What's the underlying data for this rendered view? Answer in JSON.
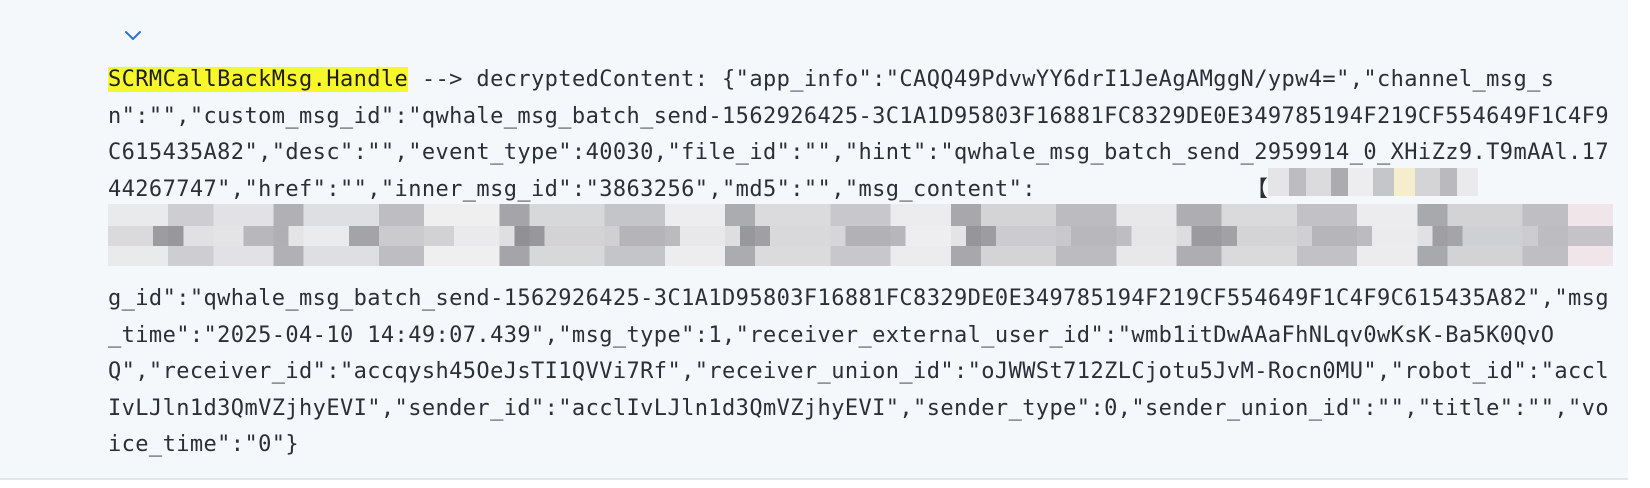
{
  "log_entry": {
    "tag": "SCRMCallBackMsg.Handle",
    "text_before_redaction": " --> decryptedContent: {\"app_info\":\"CAQQ49PdvwYY6drI1JeAgAMggN/ypw4=\",\"channel_msg_sn\":\"\",\"custom_msg_id\":\"qwhale_msg_batch_send-1562926425-3C1A1D95803F16881FC8329DE0E349785194F219CF554649F1C4F9C615435A82\",\"desc\":\"\",\"event_type\":40030,\"file_id\":\"\",\"hint\":\"qwhale_msg_batch_send_2959914_0_XHiZz9.T9mAAl.1744267747\",\"href\":\"\",\"inner_msg_id\":\"3863256\",\"md5\":\"\",\"msg_content\":",
    "redacted_tail_char": "【",
    "text_after_redaction": "g_id\":\"qwhale_msg_batch_send-1562926425-3C1A1D95803F16881FC8329DE0E349785194F219CF554649F1C4F9C615435A82\",\"msg_time\":\"2025-04-10 14:49:07.439\",\"msg_type\":1,\"receiver_external_user_id\":\"wmb1itDwAAaFhNLqv0wKsK-Ba5K0QvOQ\",\"receiver_id\":\"accqysh45OeJsTI1QVVi7Rf\",\"receiver_union_id\":\"oJWWSt712ZLCjotu5JvM-Rocn0MU\",\"robot_id\":\"acclIvLJln1d3QmVZjhyEVI\",\"sender_id\":\"acclIvLJln1d3QmVZjhyEVI\",\"sender_type\":0,\"sender_union_id\":\"\",\"title\":\"\",\"voice_time\":\"0\"}"
  },
  "icons": {
    "expand": "chevron-down-icon"
  },
  "colors": {
    "highlight": "#f7f72b",
    "accent": "#2f6fd6",
    "panel_bg": "#f5f8fb"
  }
}
